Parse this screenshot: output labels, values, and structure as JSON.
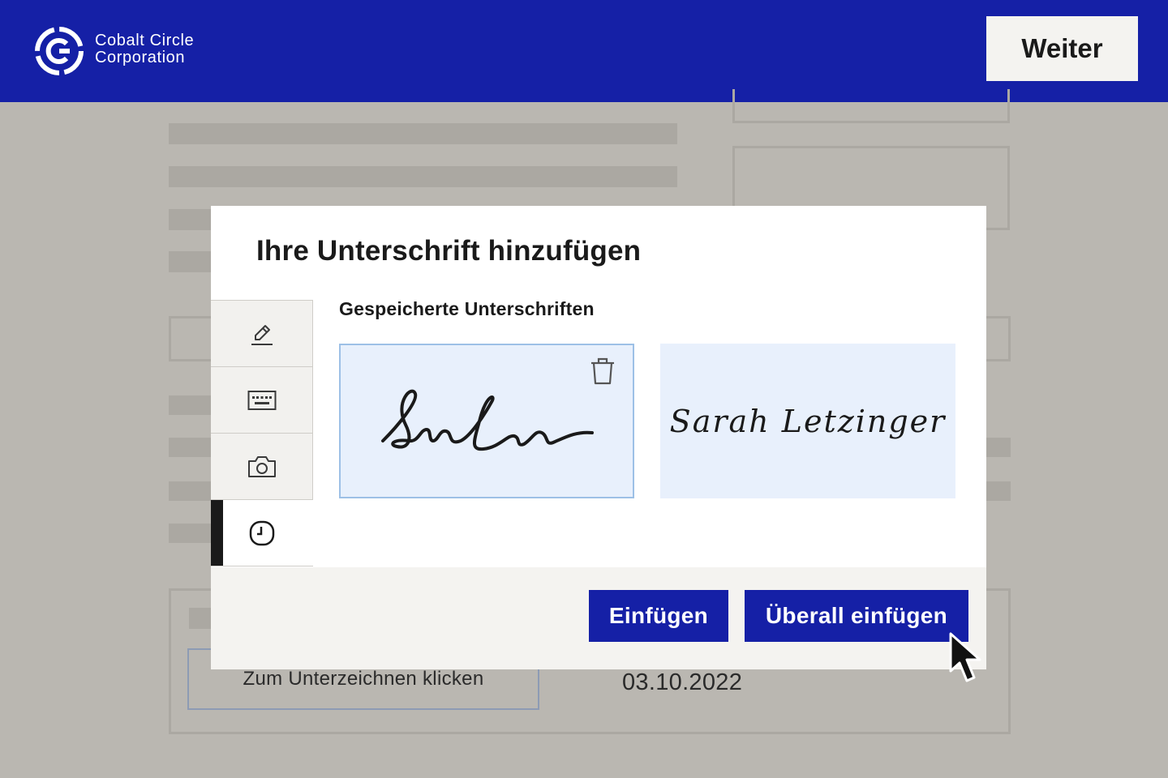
{
  "header": {
    "brand_line1": "Cobalt Circle",
    "brand_line2": "Corporation",
    "next_button": "Weiter"
  },
  "document": {
    "sign_field_label": "Zum Unterzeichnen klicken",
    "date": "03.10.2022"
  },
  "modal": {
    "title": "Ihre Unterschrift hinzufügen",
    "tabs": [
      {
        "icon": "pen-icon",
        "active": false
      },
      {
        "icon": "keyboard-icon",
        "active": false
      },
      {
        "icon": "camera-icon",
        "active": false
      },
      {
        "icon": "clock-icon",
        "active": true
      }
    ],
    "saved_label": "Gespeicherte Unterschriften",
    "signatures": [
      {
        "style": "handwritten",
        "selected": true
      },
      {
        "text": "Sarah Letzinger",
        "style": "script",
        "selected": false
      }
    ],
    "buttons": {
      "insert": "Einfügen",
      "insert_all": "Überall einfügen"
    }
  },
  "colors": {
    "brand": "#1520a6",
    "selected_card": "#e8f0fc",
    "selected_border": "#9dc0e6"
  }
}
